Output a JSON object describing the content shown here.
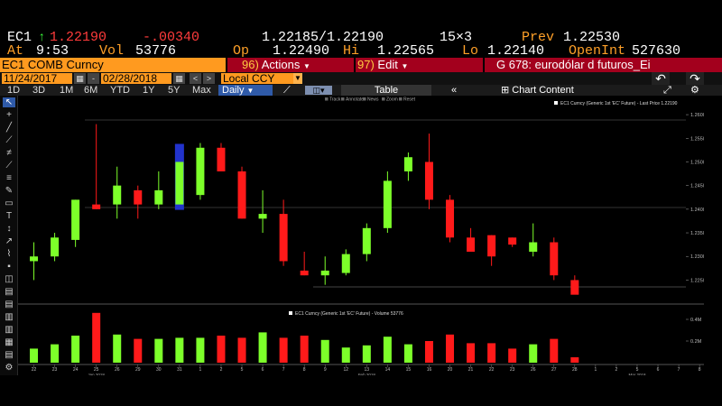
{
  "quote": {
    "ticker": "EC1",
    "last_price": "1.22190",
    "change": "-.00340",
    "bid_ask": "1.22185/1.22190",
    "size": "15×3",
    "prev_label": "Prev",
    "prev_value": "1.22530",
    "at_label": "At",
    "time": "9:53",
    "vol_label": "Vol",
    "volume": "53776",
    "open_label": "Op",
    "open": "1.22490",
    "high_label": "Hi",
    "high": "1.22565",
    "low_label": "Lo",
    "low": "1.22140",
    "openint_label": "OpenInt",
    "openint": "527630"
  },
  "security_bar": {
    "security": "EC1 COMB Curncy",
    "actions_num": "96)",
    "actions_label": "Actions",
    "edit_num": "97)",
    "edit_label": "Edit",
    "description": "G 678: eurodólar d futuros_Ei"
  },
  "date_bar": {
    "start_date": "11/24/2017",
    "end_date": "02/28/2018",
    "currency": "Local CCY"
  },
  "toolbar": {
    "periods": [
      "1D",
      "3D",
      "1M",
      "6M",
      "YTD",
      "1Y",
      "5Y",
      "Max"
    ],
    "frequency": "Daily",
    "table_label": "Table",
    "chart_content_label": "Chart Content"
  },
  "chart_header": {
    "menu_items": [
      "Track",
      "Annotate",
      "News",
      "Zoom",
      "Reset"
    ]
  },
  "colors": {
    "up": "#7dff2a",
    "down": "#ff1a1a",
    "highlight": "#2233cc"
  },
  "chart_data": [
    {
      "type": "candlestick",
      "legend": "EC1 Curncy (Generic 1st 'EC' Future) - Last Price 1.22190",
      "y_ticks": [
        1.225,
        1.23,
        1.235,
        1.24,
        1.245,
        1.25,
        1.255,
        1.26
      ],
      "ylim": [
        1.2205,
        1.2625
      ],
      "x_ticks": [
        "22",
        "23",
        "24",
        "25",
        "26",
        "29",
        "30",
        "31",
        "1",
        "2",
        "5",
        "6",
        "7",
        "8",
        "9",
        "12",
        "13",
        "14",
        "15",
        "16",
        "20",
        "21",
        "22",
        "23",
        "26",
        "27",
        "28",
        "1",
        "2",
        "5",
        "6",
        "7",
        "8"
      ],
      "x_month_labels": [
        {
          "at": "25",
          "label": "Jan 2018"
        },
        {
          "at": "13",
          "label": "Feb 2018"
        },
        {
          "at": "6",
          "label": "Mar 2018"
        }
      ],
      "candles": [
        {
          "date": "Jan 22",
          "open": 1.229,
          "high": 1.233,
          "low": 1.225,
          "close": 1.23
        },
        {
          "date": "Jan 23",
          "open": 1.23,
          "high": 1.235,
          "low": 1.229,
          "close": 1.234
        },
        {
          "date": "Jan 24",
          "open": 1.2335,
          "high": 1.242,
          "low": 1.232,
          "close": 1.242
        },
        {
          "date": "Jan 25",
          "open": 1.241,
          "high": 1.258,
          "low": 1.24,
          "close": 1.24
        },
        {
          "date": "Jan 26",
          "open": 1.241,
          "high": 1.249,
          "low": 1.238,
          "close": 1.245
        },
        {
          "date": "Jan 29",
          "open": 1.244,
          "high": 1.245,
          "low": 1.238,
          "close": 1.241
        },
        {
          "date": "Jan 30",
          "open": 1.241,
          "high": 1.248,
          "low": 1.24,
          "close": 1.244
        },
        {
          "date": "Jan 31",
          "open": 1.241,
          "high": 1.25,
          "low": 1.24,
          "close": 1.25
        },
        {
          "date": "Feb 1",
          "open": 1.243,
          "high": 1.254,
          "low": 1.242,
          "close": 1.253
        },
        {
          "date": "Feb 2",
          "open": 1.253,
          "high": 1.254,
          "low": 1.249,
          "close": 1.248
        },
        {
          "date": "Feb 5",
          "open": 1.248,
          "high": 1.249,
          "low": 1.238,
          "close": 1.238
        },
        {
          "date": "Feb 6",
          "open": 1.238,
          "high": 1.244,
          "low": 1.235,
          "close": 1.239
        },
        {
          "date": "Feb 7",
          "open": 1.239,
          "high": 1.242,
          "low": 1.228,
          "close": 1.229
        },
        {
          "date": "Feb 8",
          "open": 1.227,
          "high": 1.231,
          "low": 1.226,
          "close": 1.226
        },
        {
          "date": "Feb 9",
          "open": 1.226,
          "high": 1.23,
          "low": 1.224,
          "close": 1.227
        },
        {
          "date": "Feb 12",
          "open": 1.2265,
          "high": 1.2315,
          "low": 1.226,
          "close": 1.2305
        },
        {
          "date": "Feb 13",
          "open": 1.2305,
          "high": 1.237,
          "low": 1.229,
          "close": 1.236
        },
        {
          "date": "Feb 14",
          "open": 1.236,
          "high": 1.248,
          "low": 1.235,
          "close": 1.246
        },
        {
          "date": "Feb 15",
          "open": 1.248,
          "high": 1.252,
          "low": 1.246,
          "close": 1.251
        },
        {
          "date": "Feb 16",
          "open": 1.25,
          "high": 1.256,
          "low": 1.24,
          "close": 1.242
        },
        {
          "date": "Feb 20",
          "open": 1.242,
          "high": 1.243,
          "low": 1.233,
          "close": 1.234
        },
        {
          "date": "Feb 21",
          "open": 1.234,
          "high": 1.236,
          "low": 1.231,
          "close": 1.231
        },
        {
          "date": "Feb 22",
          "open": 1.2345,
          "high": 1.2345,
          "low": 1.228,
          "close": 1.23
        },
        {
          "date": "Feb 23",
          "open": 1.234,
          "high": 1.234,
          "low": 1.232,
          "close": 1.2325
        },
        {
          "date": "Feb 26",
          "open": 1.231,
          "high": 1.237,
          "low": 1.23,
          "close": 1.233
        },
        {
          "date": "Feb 27",
          "open": 1.233,
          "high": 1.234,
          "low": 1.225,
          "close": 1.226
        },
        {
          "date": "Feb 28",
          "open": 1.225,
          "high": 1.226,
          "low": 1.222,
          "close": 1.2219
        }
      ],
      "highlighted_candle": "Jan 31"
    },
    {
      "type": "bar",
      "legend": "EC1 Curncy (Generic 1st 'EC' Future) - Volume 53776",
      "y_ticks_label": [
        "0.2M",
        "0.4M"
      ],
      "y_ticks": [
        200000,
        400000
      ],
      "ylim": [
        0,
        500000
      ],
      "values": [
        130000,
        170000,
        250000,
        460000,
        260000,
        220000,
        220000,
        230000,
        230000,
        250000,
        230000,
        280000,
        230000,
        250000,
        210000,
        140000,
        160000,
        240000,
        170000,
        200000,
        260000,
        180000,
        180000,
        130000,
        170000,
        220000,
        50000
      ]
    }
  ]
}
